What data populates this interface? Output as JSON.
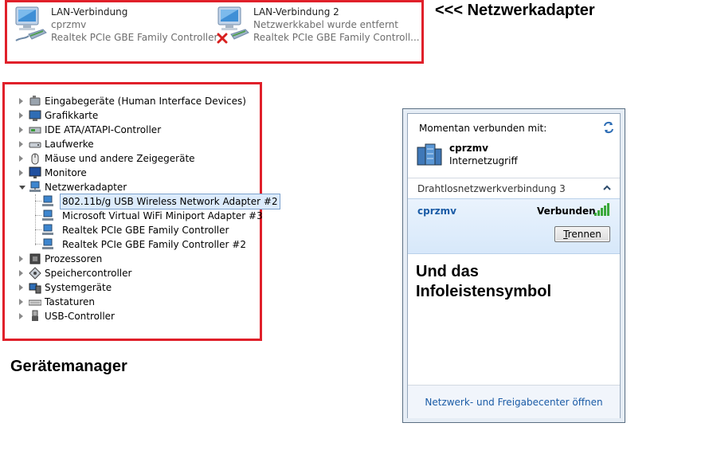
{
  "adapters": [
    {
      "name": "LAN-Verbindung",
      "status": "cprzmv",
      "device": "Realtek PCIe GBE Family Controller",
      "disconnected": false
    },
    {
      "name": "LAN-Verbindung 2",
      "status": "Netzwerkkabel wurde entfernt",
      "device": "Realtek PCIe GBE Family Controll...",
      "disconnected": true
    }
  ],
  "annotations": {
    "adapters_title": "<<< Netzwerkadapter",
    "devmgr_title": "Gerätemanager",
    "tray_title_line1": "Und das",
    "tray_title_line2": "Infoleistensymbol"
  },
  "device_manager": {
    "items": [
      {
        "label": "Eingabegeräte (Human Interface Devices)",
        "icon": "hid-icon",
        "expanded": false
      },
      {
        "label": "Grafikkarte",
        "icon": "display-adapter-icon",
        "expanded": false
      },
      {
        "label": "IDE ATA/ATAPI-Controller",
        "icon": "ide-controller-icon",
        "expanded": false
      },
      {
        "label": "Laufwerke",
        "icon": "disk-drive-icon",
        "expanded": false
      },
      {
        "label": "Mäuse und andere Zeigegeräte",
        "icon": "mouse-icon",
        "expanded": false
      },
      {
        "label": "Monitore",
        "icon": "monitor-icon",
        "expanded": false
      },
      {
        "label": "Netzwerkadapter",
        "icon": "network-adapter-icon",
        "expanded": true,
        "children": [
          {
            "label": "802.11b/g USB Wireless Network Adapter #2",
            "selected": true
          },
          {
            "label": "Microsoft Virtual WiFi Miniport Adapter #3",
            "selected": false
          },
          {
            "label": "Realtek PCIe GBE Family Controller",
            "selected": false
          },
          {
            "label": "Realtek PCIe GBE Family Controller #2",
            "selected": false
          }
        ]
      },
      {
        "label": "Prozessoren",
        "icon": "processor-icon",
        "expanded": false
      },
      {
        "label": "Speichercontroller",
        "icon": "storage-controller-icon",
        "expanded": false
      },
      {
        "label": "Systemgeräte",
        "icon": "system-devices-icon",
        "expanded": false
      },
      {
        "label": "Tastaturen",
        "icon": "keyboard-icon",
        "expanded": false
      },
      {
        "label": "USB-Controller",
        "icon": "usb-icon",
        "expanded": false
      }
    ]
  },
  "tray": {
    "connected_heading": "Momentan verbunden mit:",
    "network_name": "cprzmv",
    "network_access": "Internetzugriff",
    "wireless_section": "Drahtlosnetzwerkverbindung 3",
    "wifi_name": "cprzmv",
    "wifi_status": "Verbunden",
    "disconnect_prefix": "",
    "disconnect_underlined": "T",
    "disconnect_rest": "rennen",
    "footer_link": "Netzwerk- und Freigabecenter öffnen"
  },
  "colors": {
    "frame_red": "#e0202a",
    "link_blue": "#1a5ba6",
    "wifi_bars": "#3aa83a"
  }
}
